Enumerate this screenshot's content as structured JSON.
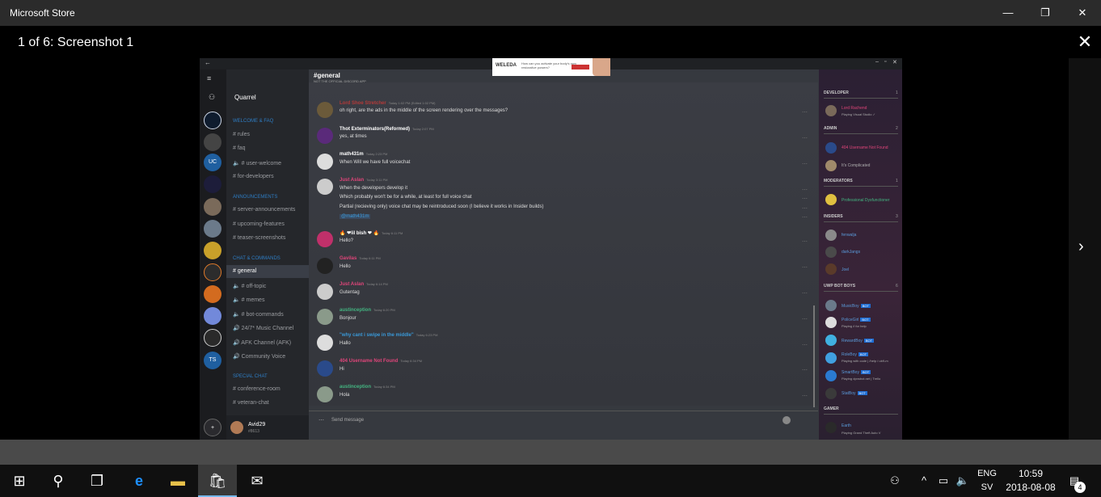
{
  "window": {
    "title": "Microsoft Store",
    "minimize": "—",
    "maximize": "❐",
    "close": "✕"
  },
  "viewer": {
    "counter": "1 of 6: Screenshot 1",
    "close": "✕",
    "next": "›"
  },
  "app": {
    "back": "←",
    "ad": {
      "brand": "WELEDA",
      "text": "How can you activate your body's own restorative powers?"
    },
    "server_name": "Quarrel",
    "header": {
      "channel": "#general",
      "subtitle": "NOT THE OFFICIAL DISCORD APP"
    },
    "guilds": [
      "UC",
      "TS",
      "+"
    ],
    "channels": [
      {
        "label": "WELCOME & FAQ",
        "cat": true
      },
      {
        "label": "# rules"
      },
      {
        "label": "# faq"
      },
      {
        "label": "🔈 # user-welcome"
      },
      {
        "label": "# for-developers"
      },
      {
        "label": "ANNOUNCEMENTS",
        "cat": true
      },
      {
        "label": "# server-announcements"
      },
      {
        "label": "# upcoming-features"
      },
      {
        "label": "# teaser-screenshots"
      },
      {
        "label": "CHAT & COMMANDS",
        "cat": true
      },
      {
        "label": "# general",
        "active": true
      },
      {
        "label": "🔈 # off-topic"
      },
      {
        "label": "🔈 # memes"
      },
      {
        "label": "🔈 # bot-commands"
      },
      {
        "label": "🔊 24/7* Music Channel"
      },
      {
        "label": "🔊 AFK Channel (AFK)"
      },
      {
        "label": "🔊 Community Voice"
      },
      {
        "label": "SPECIAL CHAT",
        "cat": true
      },
      {
        "label": "# conference-room"
      },
      {
        "label": "# veteran-chat"
      }
    ],
    "user": {
      "name": "Avid29",
      "tag": "#8613"
    },
    "messages": [
      {
        "name": "Lord Shoe Stretcher",
        "time": "Today 1:02 PM (Edited 1:02 PM)",
        "lines": [
          "oh right, are the ads in the middle of the screen rendering over the messages?"
        ],
        "color": "#b33a3a",
        "av": "#6b5a3a"
      },
      {
        "name": "Thot Exterminators(Reformed)",
        "time": "Today 2:07 PM",
        "lines": [
          "yes, at times"
        ],
        "color": "#ffffff",
        "av": "#5a2a7a"
      },
      {
        "name": "math431m",
        "time": "Today 2:23 PM",
        "lines": [
          "When Will we have full voicechat"
        ],
        "color": "#ffffff",
        "av": "#dddddd"
      },
      {
        "name": "Just Aslan",
        "time": "Today 3:11 PM",
        "lines": [
          "When the developers develop it",
          "Which probably won't be for a while, at least for full voice chat",
          "Partial (recieving only) voice chat may be reintroduced soon (I believe it works in Insider builds)",
          "@math431m"
        ],
        "color": "#e0457a",
        "av": "#cccccc"
      },
      {
        "name": "🔥 ❤lil bish ❤ 🔥",
        "time": "Today 6:11 PM",
        "lines": [
          "Hello?"
        ],
        "color": "#ffffff",
        "av": "#c0306a"
      },
      {
        "name": "Gavilas",
        "time": "Today 6:11 PM",
        "lines": [
          "Hello"
        ],
        "color": "#e0457a",
        "av": "#222222"
      },
      {
        "name": "Just Aslan",
        "time": "Today 6:14 PM",
        "lines": [
          "Gutentag"
        ],
        "color": "#e0457a",
        "av": "#cccccc"
      },
      {
        "name": "austinception",
        "time": "Today 6:20 PM",
        "lines": [
          "Bonjour"
        ],
        "color": "#43b581",
        "av": "#8a9a8a"
      },
      {
        "name": "\"why cant i swipe in the middle\"",
        "time": "Today 6:23 PM",
        "lines": [
          "Hallo"
        ],
        "color": "#3a9ad9",
        "av": "#dddddd"
      },
      {
        "name": "404 Username Not Found",
        "time": "Today 6:34 PM",
        "lines": [
          "Hi"
        ],
        "color": "#e0457a",
        "av": "#2a4a8a"
      },
      {
        "name": "austinception",
        "time": "Today 6:34 PM",
        "lines": [
          "Hola"
        ],
        "color": "#43b581",
        "av": "#8a9a8a"
      }
    ],
    "input_placeholder": "Send message",
    "member_groups": [
      {
        "title": "DEVELOPER",
        "count": "1",
        "members": [
          {
            "name": "Lord Rachend",
            "status": "Playing Visual Studio ✓",
            "color": "#e0457a"
          }
        ]
      },
      {
        "title": "ADMIN",
        "count": "2",
        "members": [
          {
            "name": "404 Username Not Found",
            "color": "#e0457a"
          },
          {
            "name": "It's Complicated",
            "color": "#b0b0b0"
          }
        ]
      },
      {
        "title": "MODERATORS",
        "count": "1",
        "members": [
          {
            "name": "Professional Dysfunctioner",
            "color": "#43b581"
          }
        ]
      },
      {
        "title": "INSIDERS",
        "count": "3",
        "members": [
          {
            "name": "fenwalja",
            "color": "#5a9ad9"
          },
          {
            "name": "darkJangs",
            "color": "#5a9ad9"
          },
          {
            "name": "Joel",
            "color": "#5a9ad9"
          }
        ]
      },
      {
        "title": "UWP BOT BOYS",
        "count": "6",
        "members": [
          {
            "name": "MusicBoy",
            "bot": "BOT",
            "color": "#5a9ad9"
          },
          {
            "name": "PoliceGirl",
            "bot": "BOT",
            "status": "Playing /i for help",
            "color": "#5a9ad9"
          },
          {
            "name": "RewardBoy",
            "bot": "BOT",
            "color": "#5a9ad9"
          },
          {
            "name": "RoleBoy",
            "bot": "BOT",
            "status": "Playing with code | /help / ub9-m",
            "color": "#5a9ad9"
          },
          {
            "name": "SmartBoy",
            "bot": "BOT",
            "status": "Playing dpnsbot.net | Trello",
            "color": "#5a9ad9"
          },
          {
            "name": "StatBoy",
            "bot": "BOT",
            "color": "#5a9ad9"
          }
        ]
      },
      {
        "title": "GAMER",
        "count": "",
        "members": [
          {
            "name": "Earth",
            "status": "Playing Grand Theft Auto V",
            "color": "#5a9ad9"
          }
        ]
      }
    ]
  },
  "taskbar": {
    "lang_1": "ENG",
    "lang_2": "SV",
    "time": "10:59",
    "date": "2018-08-08",
    "notifications": "4"
  }
}
